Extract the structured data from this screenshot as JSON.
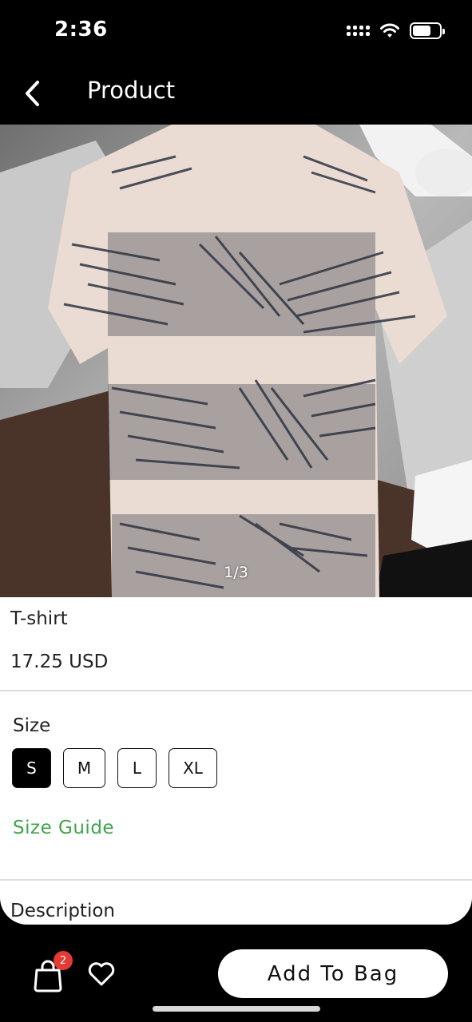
{
  "status_bar": {
    "time": "2:36"
  },
  "nav": {
    "title": "Product",
    "back_icon": "chevron-left-icon"
  },
  "gallery": {
    "counter": "1/3"
  },
  "product": {
    "name": "T-shirt",
    "price": "17.25 USD"
  },
  "size": {
    "label": "Size",
    "options": [
      "S",
      "M",
      "L",
      "XL"
    ],
    "selected": "S",
    "guide_link": "Size Guide"
  },
  "description": {
    "label": "Description"
  },
  "bottom_bar": {
    "bag_icon": "shopping-bag-icon",
    "bag_count": "2",
    "wishlist_icon": "heart-icon",
    "add_to_bag": "Add To Bag"
  },
  "colors": {
    "accent_green": "#3fa54a",
    "badge_red": "#e53935",
    "selected_size": "#000000"
  }
}
